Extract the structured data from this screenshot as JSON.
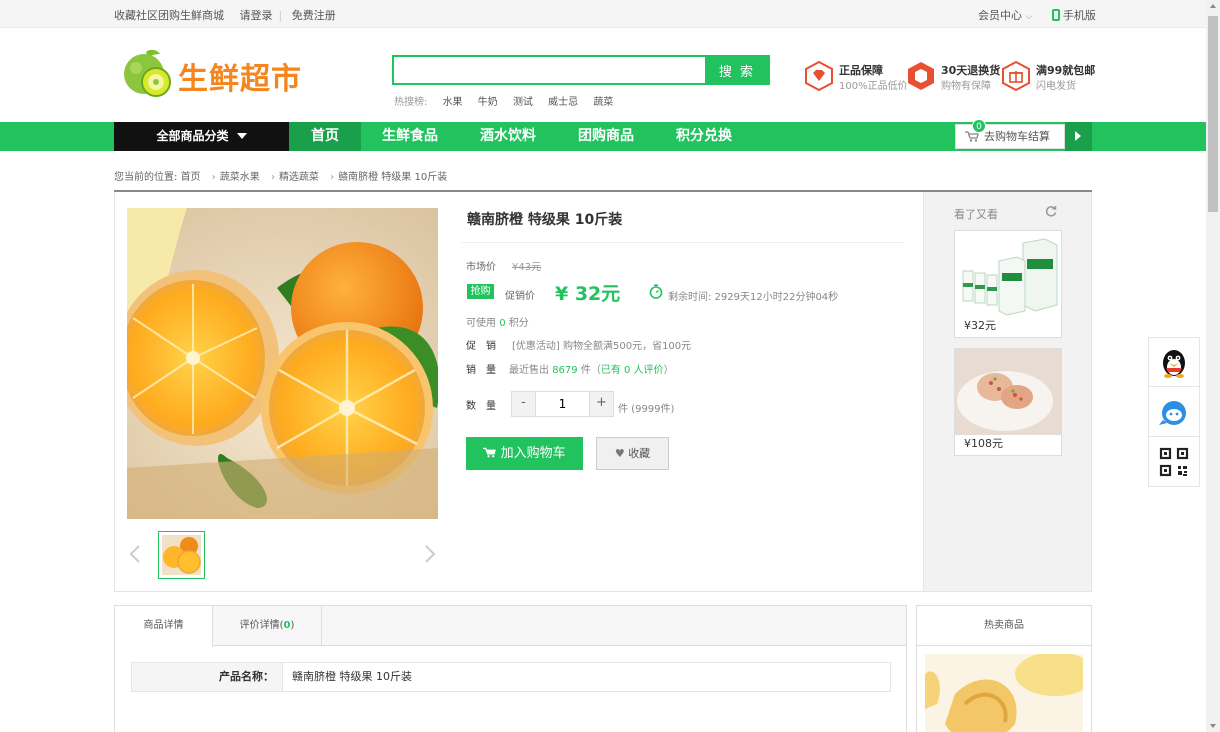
{
  "topbar": {
    "favorite": "收藏社区团购生鲜商城",
    "login": "请登录",
    "register": "免费注册",
    "member": "会员中心",
    "mobile": "手机版"
  },
  "header": {
    "logo_text": "生鲜超市",
    "search_button": "搜 索",
    "search_value": "",
    "hot_label": "热搜榜:",
    "hot_words": [
      "水果",
      "牛奶",
      "测试",
      "威士忌",
      "蔬菜"
    ],
    "guarantees": [
      {
        "title": "正品保障",
        "sub": "100%正品低价"
      },
      {
        "title": "30天退换货",
        "sub": "购物有保障"
      },
      {
        "title": "满99就包邮",
        "sub": "闪电发货"
      }
    ]
  },
  "nav": {
    "all_categories": "全部商品分类",
    "items": [
      "首页",
      "生鲜食品",
      "酒水饮料",
      "团购商品",
      "积分兑换"
    ],
    "cart_label": "去购物车结算",
    "cart_count": "0"
  },
  "breadcrumb": {
    "prefix": "您当前的位置:",
    "items": [
      "首页",
      "蔬菜水果",
      "精选蔬菜",
      "赣南脐橙 特级果 10斤装"
    ]
  },
  "product": {
    "title": "赣南脐橙 特级果 10斤装",
    "market_label": "市场价",
    "market_price": "¥43元",
    "buy_badge": "抢购",
    "sale_label": "促销价",
    "sale_price": "¥ 32元",
    "timer": "剩余时间: 2929天12小时22分钟04秒",
    "points_prefix": "可使用",
    "points_value": "0",
    "points_suffix": "积分",
    "promo_label": "促　销",
    "promo_text": "[优惠活动] 购物全额满500元，省100元",
    "sales_label": "销　量",
    "sales_prefix": "最近售出",
    "sales_count": "8679",
    "sales_mid": "件（",
    "sales_review": "已有 0 人评价",
    "sales_suffix": "）",
    "qty_label": "数　量",
    "qty_value": "1",
    "qty_minus": "-",
    "qty_plus": "+",
    "stock": "件  (9999件)",
    "add_cart": "加入购物车",
    "favorite": "收藏"
  },
  "also_viewed": {
    "title": "看了又看",
    "items": [
      {
        "price": "¥32元"
      },
      {
        "price": "¥108元"
      }
    ]
  },
  "tabs": {
    "detail": "商品详情",
    "review_prefix": "评价详情(",
    "review_count": "0",
    "review_suffix": ")",
    "spec_key": "产品名称：",
    "spec_value": "赣南脐橙 特级果 10斤装"
  },
  "hot": {
    "title": "热卖商品"
  },
  "colors": {
    "brand_green": "#22c35e",
    "logo_orange": "#f5861f",
    "guarantee_red": "#e8502f"
  }
}
